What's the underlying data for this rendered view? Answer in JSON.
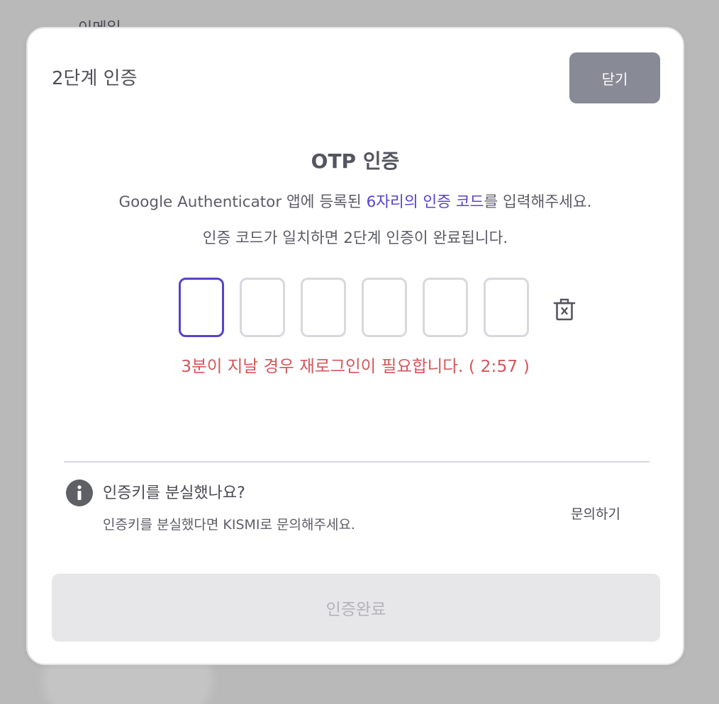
{
  "background": {
    "partial_label": "이메일"
  },
  "modal": {
    "title": "2단계 인증",
    "close_label": "닫기"
  },
  "otp": {
    "title": "OTP 인증",
    "desc_line1_prefix": "Google Authenticator 앱에 등록된 ",
    "desc_line1_highlight": "6자리의 인증 코드",
    "desc_line1_suffix": "를 입력해주세요.",
    "desc_line2": "인증 코드가 일치하면 2단계 인증이 완료됩니다.",
    "digits": [
      "",
      "",
      "",
      "",
      "",
      ""
    ],
    "timer_text": "3분이 지날 경우 재로그인이 필요합니다. ( 2:57 )"
  },
  "help": {
    "title": "인증키를 분실했나요?",
    "description": "인증키를 분실했다면 KISMI로 문의해주세요.",
    "link_label": "문의하기"
  },
  "footer": {
    "confirm_label": "인증완료"
  },
  "icons": {
    "clear": "trash-icon",
    "info": "info-icon"
  },
  "colors": {
    "accent": "#5a42c9",
    "warning": "#d3575a",
    "close_button": "#888a96",
    "disabled_button": "#e7e7ea"
  }
}
